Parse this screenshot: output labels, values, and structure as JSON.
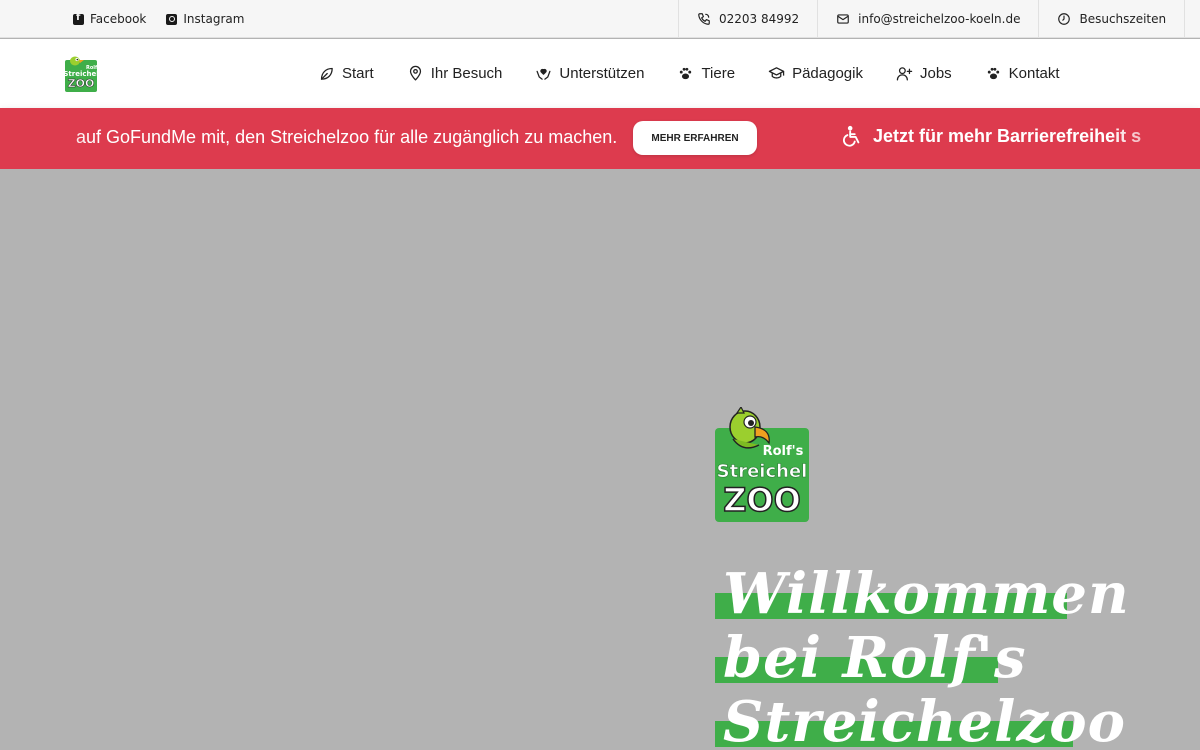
{
  "topbar": {
    "social": [
      {
        "label": "Facebook",
        "icon": "facebook-icon"
      },
      {
        "label": "Instagram",
        "icon": "instagram-icon"
      }
    ],
    "contact": [
      {
        "label": "02203 84992",
        "icon": "phone-icon"
      },
      {
        "label": "info@streichelzoo-koeln.de",
        "icon": "mail-icon"
      },
      {
        "label": "Besuchszeiten",
        "icon": "clock-icon"
      }
    ]
  },
  "logo": {
    "line1": "Rolf's",
    "line2": "Streichel",
    "line3": "ZOO"
  },
  "nav": {
    "items": [
      {
        "label": "Start",
        "icon": "leaf-icon"
      },
      {
        "label": "Ihr Besuch",
        "icon": "map-pin-icon"
      },
      {
        "label": "Unterstützen",
        "icon": "hands-heart-icon"
      },
      {
        "label": "Tiere",
        "icon": "paw-icon"
      },
      {
        "label": "Pädagogik",
        "icon": "graduation-cap-icon"
      },
      {
        "label": "Jobs",
        "icon": "user-plus-icon"
      },
      {
        "label": "Kontakt",
        "icon": "paw-icon"
      }
    ]
  },
  "banner": {
    "text": "auf GoFundMe mit, den Streichelzoo für alle zugänglich zu machen.",
    "button": "MEHR ERFAHREN",
    "next_text": "Jetzt für mehr Barrierefreiheit s",
    "next_icon": "wheelchair-icon"
  },
  "hero": {
    "title_lines": [
      "Willkommen",
      "bei Rolf's",
      "Streichelzoo"
    ]
  },
  "colors": {
    "banner": "#dd3b4e",
    "brand_green": "#3fae49",
    "hero_bg": "#b3b3b3"
  }
}
